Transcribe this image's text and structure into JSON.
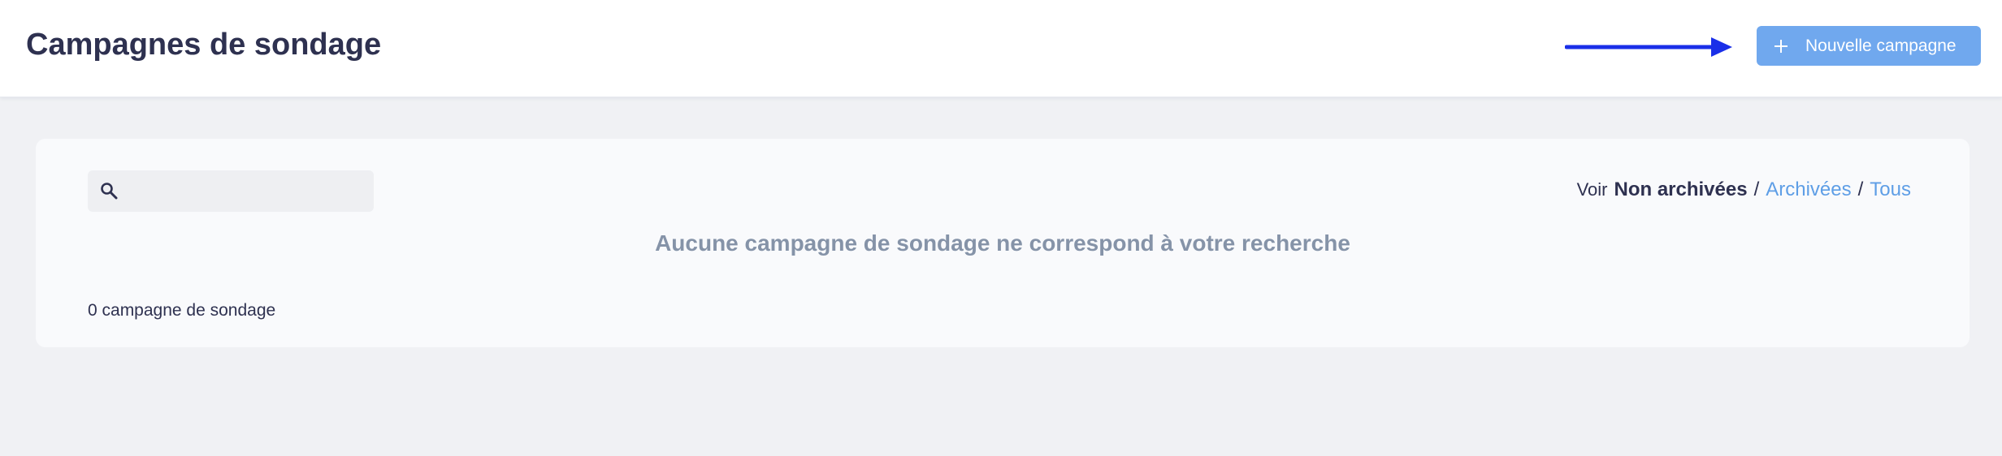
{
  "header": {
    "title": "Campagnes de sondage",
    "new_button_label": "Nouvelle campagne"
  },
  "filters": {
    "prefix": "Voir",
    "active": "Non archivées",
    "separator": "/",
    "archived": "Archivées",
    "all": "Tous"
  },
  "search": {
    "placeholder": "",
    "value": ""
  },
  "main": {
    "empty_message": "Aucune campagne de sondage ne correspond à votre recherche",
    "count_text": "0 campagne de sondage"
  },
  "colors": {
    "primary_button": "#70a8ee",
    "link": "#5e9ee6",
    "title_text": "#2e3150",
    "annotation_arrow": "#1a2fe8"
  },
  "icons": {
    "search": "search-icon",
    "plus": "plus-icon",
    "arrow": "arrow-right-icon"
  }
}
